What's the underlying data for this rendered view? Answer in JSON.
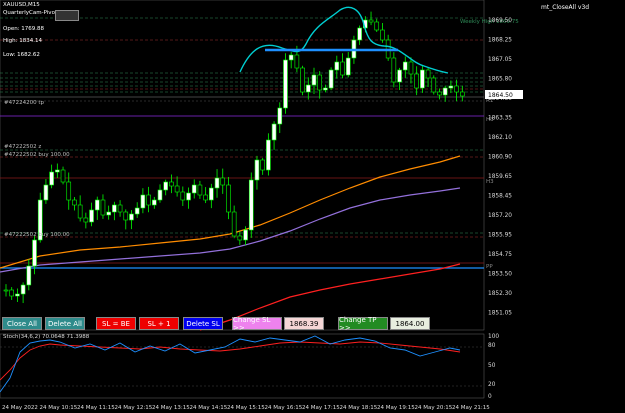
{
  "header": {
    "symbol": "XAUUSD,M15",
    "indicator": "QuarterlyCam-Pivots (Ray)",
    "ea_label": "mt_CloseAll v3d"
  },
  "info_panel": {
    "open": "Open: 1769.88",
    "high": "High: 1834.14",
    "low": "Low: 1682.62"
  },
  "levels": {
    "weekly_high": "Weekly High 1869.75",
    "r1": "R1",
    "h3_top": "H3",
    "h3_mid": "H3",
    "pp": "PP",
    "order1": "#47222502 z",
    "order2": "#47222502 buy 100.00",
    "order3": "#47222502 buy 100.00",
    "order_tp": "#47224200 tp",
    "price_label": "1864.50"
  },
  "price_axis": [
    "1869.50",
    "1868.25",
    "1867.05",
    "1865.80",
    "1864.50",
    "1863.35",
    "1862.10",
    "1860.90",
    "1859.65",
    "1858.45",
    "1857.20",
    "1855.95",
    "1854.75",
    "1853.50",
    "1852.30",
    "1851.05"
  ],
  "time_axis": [
    "24 May 2022",
    "24 May 10:15",
    "24 May 11:15",
    "24 May 12:15",
    "24 May 13:15",
    "24 May 14:15",
    "24 May 15:15",
    "24 May 16:15",
    "24 May 17:15",
    "24 May 18:15",
    "24 May 19:15",
    "24 May 20:15",
    "24 May 21:15"
  ],
  "stoch": {
    "label": "Stoch(34,6,2) 70.0648 71.3988",
    "axis": [
      "100",
      "80",
      "50",
      "20",
      "0"
    ]
  },
  "buttons": {
    "close_all": "Close All",
    "delete_all": "Delete All",
    "sl_be": "SL = BE",
    "sl_plus1": "SL + 1",
    "delete_sl": "Delete SL",
    "change_sl": "Change SL >>",
    "sl_value": "1868.39",
    "change_tp": "Change TP >>",
    "tp_value": "1864.00"
  },
  "colors": {
    "bull": "#00ff00",
    "candle": "#ffffff",
    "orange_ma": "#ff8c00",
    "purple_ma": "#9370db",
    "red_ma": "#ff0000",
    "blue_line": "#1e90ff",
    "cyan_pattern": "#00ced1"
  }
}
